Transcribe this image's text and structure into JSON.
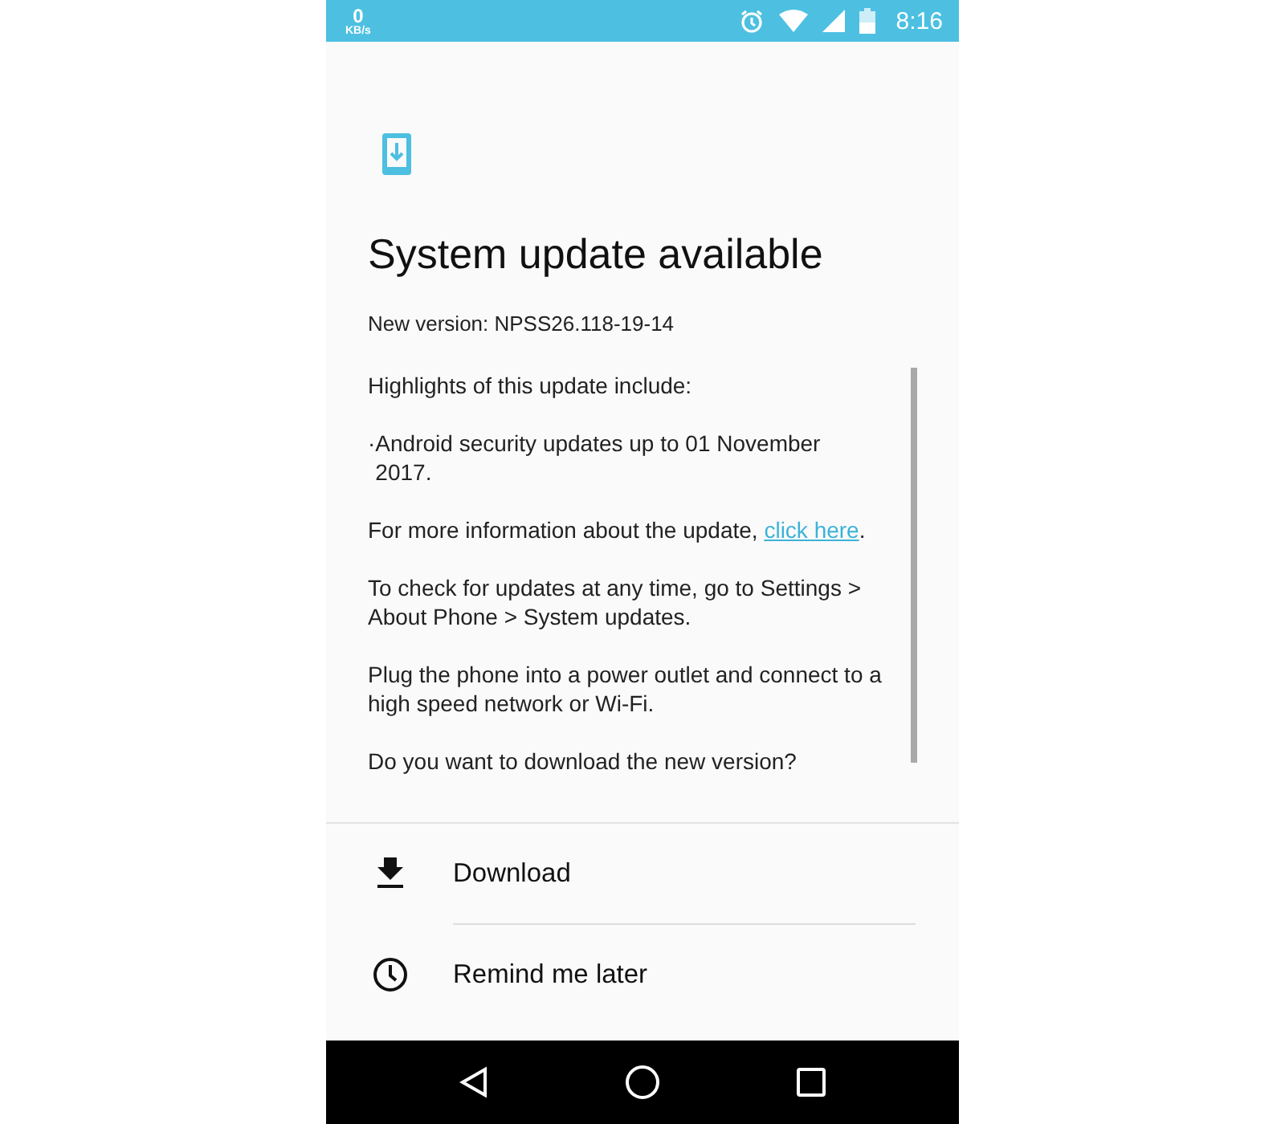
{
  "status_bar": {
    "net_speed": "0",
    "net_unit": "KB/s",
    "time": "8:16"
  },
  "dialog": {
    "title": "System update available",
    "version": "New version: NPSS26.118-19-14",
    "paragraphs": [
      {
        "kind": "text",
        "text": "Highlights of this update include:"
      },
      {
        "kind": "bullet",
        "bullet": "·",
        "text": "Android security updates up to 01 November 2017."
      },
      {
        "kind": "link",
        "text": "For more information about the update, ",
        "link": "click here",
        "after": "."
      },
      {
        "kind": "text",
        "text": "To check for updates at any time, go to Settings > About Phone > System updates."
      },
      {
        "kind": "text",
        "text": "Plug the phone into a power outlet and connect to a high speed network or Wi-Fi."
      },
      {
        "kind": "text",
        "text": "Do you want to download the new version?"
      }
    ]
  },
  "actions": [
    {
      "kind": "download",
      "label": "Download"
    },
    {
      "kind": "clock",
      "label": "Remind me later"
    }
  ]
}
